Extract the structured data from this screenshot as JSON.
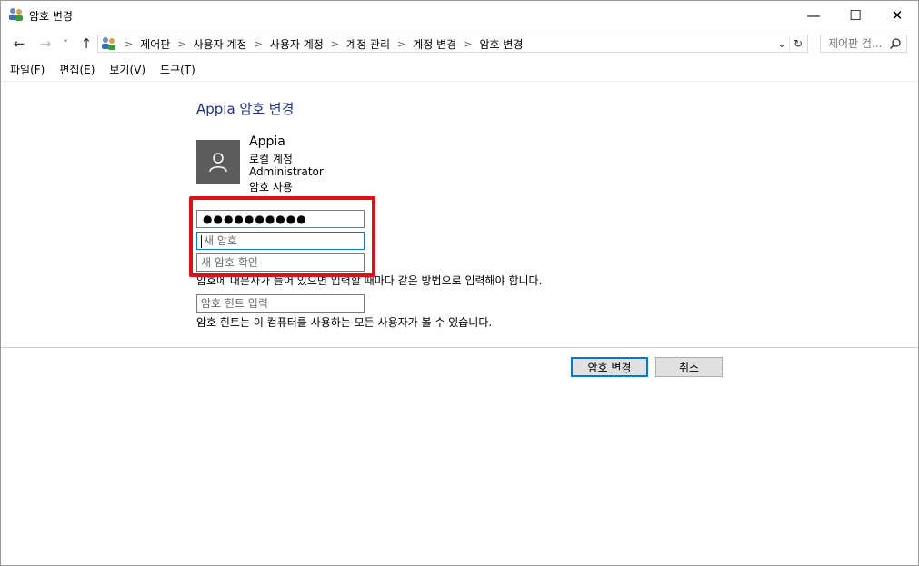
{
  "window": {
    "title": "암호 변경",
    "minimize_glyph": "—",
    "maximize_glyph": "☐",
    "close_glyph": "✕"
  },
  "nav": {
    "back_glyph": "←",
    "forward_glyph": "→",
    "recent_glyph": "˅",
    "up_glyph": "↑",
    "breadcrumbs": [
      "제어판",
      "사용자 계정",
      "사용자 계정",
      "계정 관리",
      "계정 변경",
      "암호 변경"
    ],
    "search_placeholder": "제어판 검..."
  },
  "menu": [
    "파일(F)",
    "편집(E)",
    "보기(V)",
    "도구(T)"
  ],
  "main": {
    "title": "Appia 암호 변경",
    "user": {
      "name": "Appia",
      "account_type": "로컬 계정",
      "role": "Administrator",
      "password_status": "암호 사용"
    },
    "current_password_value": "●●●●●●●●●●",
    "new_password_placeholder": "새 암호",
    "confirm_password_placeholder": "새 암호 확인",
    "case_note": "암호에 대문자가 들어 있으면 입력할 때마다 같은 방법으로 입력해야 합니다.",
    "hint_placeholder": "암호 힌트 입력",
    "hint_note": "암호 힌트는 이 컴퓨터를 사용하는 모든 사용자가 볼 수 있습니다.",
    "change_button": "암호 변경",
    "cancel_button": "취소"
  },
  "colors": {
    "title_blue": "#1e3287",
    "highlight_red": "#e0101b",
    "focus_blue": "#0078d7",
    "avatar_gray": "#5c5c5c"
  },
  "icons": [
    "users-icon",
    "search-icon",
    "user-silhouette-icon",
    "refresh-icon",
    "chevron-down-icon"
  ]
}
